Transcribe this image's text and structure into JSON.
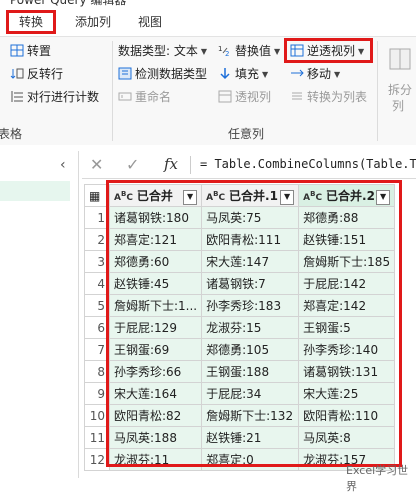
{
  "title_fragment": "Power Query 编辑器",
  "tabs": [
    "转换",
    "添加列",
    "视图"
  ],
  "ribbon": {
    "group1": {
      "items": [
        "转置",
        "反转行",
        "对行进行计数"
      ],
      "label": "表格"
    },
    "group2": {
      "col1": [
        "数据类型: 文本",
        "检测数据类型",
        "重命名"
      ],
      "col2": [
        "替换值",
        "填充",
        "透视列"
      ],
      "col3": [
        "逆透视列",
        "移动",
        "转换为列表"
      ],
      "label": "任意列"
    },
    "group3": {
      "items": [
        "拆分",
        "列"
      ]
    }
  },
  "formula": {
    "text": "= Table.CombineColumns(Table.Tra",
    "fx": "fx"
  },
  "table": {
    "columns": [
      "已合并",
      "已合并.1",
      "已合并.2"
    ],
    "rows": [
      [
        "1",
        "诸葛钢铁:180",
        "马凤英:75",
        "郑德勇:88"
      ],
      [
        "2",
        "郑喜定:121",
        "欧阳青松:111",
        "赵铁锤:151"
      ],
      [
        "3",
        "郑德勇:60",
        "宋大莲:147",
        "詹姆斯下士:185"
      ],
      [
        "4",
        "赵铁锤:45",
        "诸葛钢铁:7",
        "于屁屁:142"
      ],
      [
        "5",
        "詹姆斯下士:1...",
        "孙李秀珍:183",
        "郑喜定:142"
      ],
      [
        "6",
        "于屁屁:129",
        "龙淑芬:15",
        "王钢蛋:5"
      ],
      [
        "7",
        "王钢蛋:69",
        "郑德勇:105",
        "孙李秀珍:140"
      ],
      [
        "8",
        "孙李秀珍:66",
        "王钢蛋:188",
        "诸葛钢铁:131"
      ],
      [
        "9",
        "宋大莲:164",
        "于屁屁:34",
        "宋大莲:25"
      ],
      [
        "10",
        "欧阳青松:82",
        "詹姆斯下士:132",
        "欧阳青松:110"
      ],
      [
        "11",
        "马凤英:188",
        "赵铁锤:21",
        "马凤英:8"
      ],
      [
        "12",
        "龙淑芬:11",
        "郑喜定:0",
        "龙淑芬:157"
      ]
    ]
  },
  "watermark": "Excel学习世界"
}
